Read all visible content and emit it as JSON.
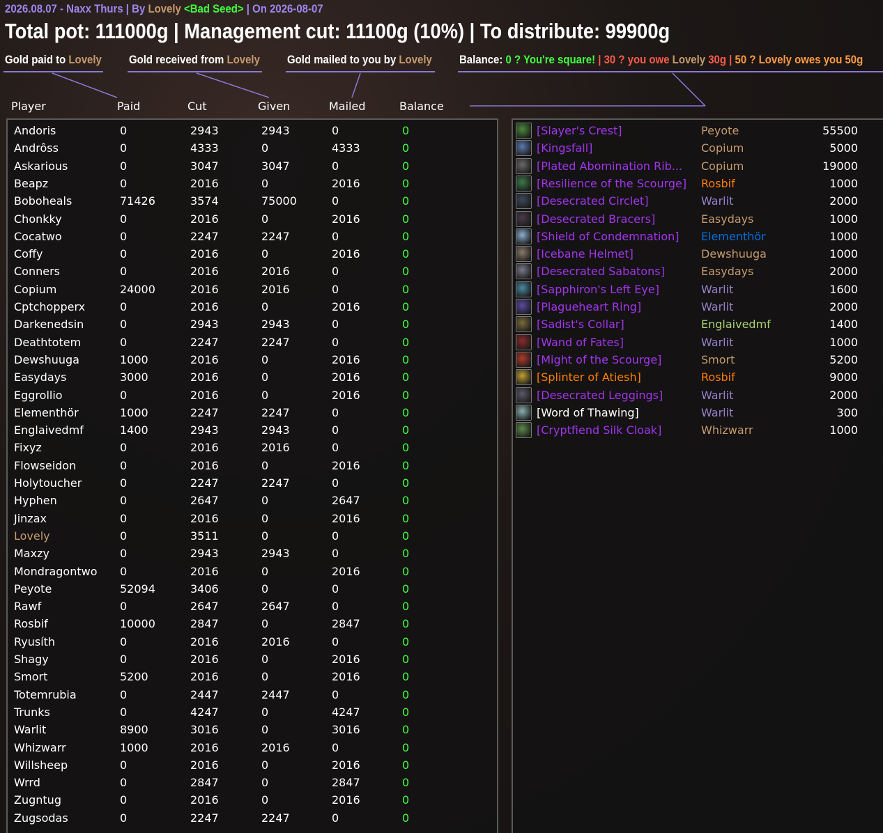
{
  "header": {
    "date": "2026.08.07",
    "sub_mid": " - Naxx Thurs | By ",
    "leader": "Lovely",
    "guild": "<Bad Seed>",
    "sub_end": " | On 2026-08-07",
    "title": "Total pot: 111000g | Management cut: 11100g (10%) | To distribute: 99900g"
  },
  "legend": {
    "paid_prefix": "Gold paid to ",
    "received_prefix": "Gold received from ",
    "mailed_prefix": "Gold mailed to you by ",
    "leader": "Lovely",
    "balance_label": "Balance: ",
    "square_text": "0 ? You're square!",
    "sep": " | ",
    "owe_prefix": "30 ? you owe ",
    "owe_suffix": " 30g",
    "owes_text": "50 ? Lovely owes you 50g"
  },
  "columns": {
    "player": "Player",
    "paid": "Paid",
    "cut": "Cut",
    "given": "Given",
    "mailed": "Mailed",
    "balance": "Balance"
  },
  "colors": {
    "purple_epic": "#a335ee",
    "legendary": "#ff8000",
    "shaman": "#0070dd",
    "hunter": "#abd473",
    "priest": "#ffffff",
    "balance_green": "#40ff40",
    "leader": "#c69b6d"
  },
  "players": [
    {
      "name": "Andoris",
      "paid": "0",
      "cut": "2943",
      "given": "2943",
      "mailed": "0",
      "balance": "0"
    },
    {
      "name": "Andrôss",
      "paid": "0",
      "cut": "4333",
      "given": "0",
      "mailed": "4333",
      "balance": "0"
    },
    {
      "name": "Askarious",
      "paid": "0",
      "cut": "3047",
      "given": "3047",
      "mailed": "0",
      "balance": "0"
    },
    {
      "name": "Beapz",
      "paid": "0",
      "cut": "2016",
      "given": "0",
      "mailed": "2016",
      "balance": "0"
    },
    {
      "name": "Boboheals",
      "paid": "71426",
      "cut": "3574",
      "given": "75000",
      "mailed": "0",
      "balance": "0"
    },
    {
      "name": "Chonkky",
      "paid": "0",
      "cut": "2016",
      "given": "0",
      "mailed": "2016",
      "balance": "0"
    },
    {
      "name": "Cocatwo",
      "paid": "0",
      "cut": "2247",
      "given": "2247",
      "mailed": "0",
      "balance": "0"
    },
    {
      "name": "Coffy",
      "paid": "0",
      "cut": "2016",
      "given": "0",
      "mailed": "2016",
      "balance": "0"
    },
    {
      "name": "Conners",
      "paid": "0",
      "cut": "2016",
      "given": "2016",
      "mailed": "0",
      "balance": "0"
    },
    {
      "name": "Copium",
      "paid": "24000",
      "cut": "2016",
      "given": "2016",
      "mailed": "0",
      "balance": "0"
    },
    {
      "name": "Cptchopperx",
      "paid": "0",
      "cut": "2016",
      "given": "0",
      "mailed": "2016",
      "balance": "0"
    },
    {
      "name": "Darkenedsin",
      "paid": "0",
      "cut": "2943",
      "given": "2943",
      "mailed": "0",
      "balance": "0"
    },
    {
      "name": "Deathtotem",
      "paid": "0",
      "cut": "2247",
      "given": "2247",
      "mailed": "0",
      "balance": "0"
    },
    {
      "name": "Dewshuuga",
      "paid": "1000",
      "cut": "2016",
      "given": "0",
      "mailed": "2016",
      "balance": "0"
    },
    {
      "name": "Easydays",
      "paid": "3000",
      "cut": "2016",
      "given": "0",
      "mailed": "2016",
      "balance": "0"
    },
    {
      "name": "Eggrollio",
      "paid": "0",
      "cut": "2016",
      "given": "0",
      "mailed": "2016",
      "balance": "0"
    },
    {
      "name": "Elementhör",
      "paid": "1000",
      "cut": "2247",
      "given": "2247",
      "mailed": "0",
      "balance": "0"
    },
    {
      "name": "Englaivedmf",
      "paid": "1400",
      "cut": "2943",
      "given": "2943",
      "mailed": "0",
      "balance": "0"
    },
    {
      "name": "Fixyz",
      "paid": "0",
      "cut": "2016",
      "given": "2016",
      "mailed": "0",
      "balance": "0"
    },
    {
      "name": "Flowseidon",
      "paid": "0",
      "cut": "2016",
      "given": "0",
      "mailed": "2016",
      "balance": "0"
    },
    {
      "name": "Holytoucher",
      "paid": "0",
      "cut": "2247",
      "given": "2247",
      "mailed": "0",
      "balance": "0"
    },
    {
      "name": "Hyphen",
      "paid": "0",
      "cut": "2647",
      "given": "0",
      "mailed": "2647",
      "balance": "0"
    },
    {
      "name": "Jinzax",
      "paid": "0",
      "cut": "2016",
      "given": "0",
      "mailed": "2016",
      "balance": "0"
    },
    {
      "name": "Lovely",
      "paid": "0",
      "cut": "3511",
      "given": "0",
      "mailed": "0",
      "balance": "0",
      "leader": true
    },
    {
      "name": "Maxzy",
      "paid": "0",
      "cut": "2943",
      "given": "2943",
      "mailed": "0",
      "balance": "0"
    },
    {
      "name": "Mondragontwo",
      "paid": "0",
      "cut": "2016",
      "given": "0",
      "mailed": "2016",
      "balance": "0"
    },
    {
      "name": "Peyote",
      "paid": "52094",
      "cut": "3406",
      "given": "0",
      "mailed": "0",
      "balance": "0"
    },
    {
      "name": "Rawf",
      "paid": "0",
      "cut": "2647",
      "given": "2647",
      "mailed": "0",
      "balance": "0"
    },
    {
      "name": "Rosbif",
      "paid": "10000",
      "cut": "2847",
      "given": "0",
      "mailed": "2847",
      "balance": "0"
    },
    {
      "name": "Ryusíth",
      "paid": "0",
      "cut": "2016",
      "given": "2016",
      "mailed": "0",
      "balance": "0"
    },
    {
      "name": "Shagy",
      "paid": "0",
      "cut": "2016",
      "given": "0",
      "mailed": "2016",
      "balance": "0"
    },
    {
      "name": "Smort",
      "paid": "5200",
      "cut": "2016",
      "given": "0",
      "mailed": "2016",
      "balance": "0"
    },
    {
      "name": "Totemrubia",
      "paid": "0",
      "cut": "2447",
      "given": "2447",
      "mailed": "0",
      "balance": "0"
    },
    {
      "name": "Trunks",
      "paid": "0",
      "cut": "4247",
      "given": "0",
      "mailed": "4247",
      "balance": "0"
    },
    {
      "name": "Warlit",
      "paid": "8900",
      "cut": "3016",
      "given": "0",
      "mailed": "3016",
      "balance": "0"
    },
    {
      "name": "Whizwarr",
      "paid": "1000",
      "cut": "2016",
      "given": "2016",
      "mailed": "0",
      "balance": "0"
    },
    {
      "name": "Willsheep",
      "paid": "0",
      "cut": "2016",
      "given": "0",
      "mailed": "2016",
      "balance": "0"
    },
    {
      "name": "Wrrd",
      "paid": "0",
      "cut": "2847",
      "given": "0",
      "mailed": "2847",
      "balance": "0"
    },
    {
      "name": "Zugntug",
      "paid": "0",
      "cut": "2016",
      "given": "0",
      "mailed": "2016",
      "balance": "0"
    },
    {
      "name": "Zugsodas",
      "paid": "0",
      "cut": "2247",
      "given": "2247",
      "mailed": "0",
      "balance": "0"
    }
  ],
  "items": [
    {
      "name": "[Slayer's Crest]",
      "winner": "Peyote",
      "price": "55500",
      "item_color": "#a335ee",
      "winner_color": "#c69b6d",
      "icon": "crest-icon",
      "icon_color": "#4a8a3a"
    },
    {
      "name": "[Kingsfall]",
      "winner": "Copium",
      "price": "5000",
      "item_color": "#a335ee",
      "winner_color": "#c69b6d",
      "icon": "dagger-icon",
      "icon_color": "#5a7ab0"
    },
    {
      "name": "[Plated Abomination Rib...",
      "winner": "Copium",
      "price": "19000",
      "item_color": "#a335ee",
      "winner_color": "#c69b6d",
      "icon": "chest-armor-icon",
      "icon_color": "#6a6a6a"
    },
    {
      "name": "[Resilience of the Scourge]",
      "winner": "Rosbif",
      "price": "1000",
      "item_color": "#a335ee",
      "winner_color": "#ff7d0a",
      "icon": "trinket-icon",
      "icon_color": "#3a7a4a"
    },
    {
      "name": "[Desecrated Circlet]",
      "winner": "Warlit",
      "price": "2000",
      "item_color": "#a335ee",
      "winner_color": "#9482c9",
      "icon": "helm-icon",
      "icon_color": "#3a4a5a"
    },
    {
      "name": "[Desecrated Bracers]",
      "winner": "Easydays",
      "price": "1000",
      "item_color": "#a335ee",
      "winner_color": "#c69b6d",
      "icon": "bracers-icon",
      "icon_color": "#4a3a4a"
    },
    {
      "name": "[Shield of Condemnation]",
      "winner": "Elementhör",
      "price": "1000",
      "item_color": "#a335ee",
      "winner_color": "#0070dd",
      "icon": "shield-icon",
      "icon_color": "#8ab0d0"
    },
    {
      "name": "[Icebane Helmet]",
      "winner": "Dewshuuga",
      "price": "1000",
      "item_color": "#a335ee",
      "winner_color": "#c69b6d",
      "icon": "helmet-icon",
      "icon_color": "#8a7a6a"
    },
    {
      "name": "[Desecrated Sabatons]",
      "winner": "Easydays",
      "price": "2000",
      "item_color": "#a335ee",
      "winner_color": "#c69b6d",
      "icon": "boots-icon",
      "icon_color": "#7a7a8a"
    },
    {
      "name": "[Sapphiron's Left Eye]",
      "winner": "Warlit",
      "price": "1600",
      "item_color": "#a335ee",
      "winner_color": "#9482c9",
      "icon": "eye-icon",
      "icon_color": "#4a8aa0"
    },
    {
      "name": "[Plagueheart Ring]",
      "winner": "Warlit",
      "price": "2000",
      "item_color": "#a335ee",
      "winner_color": "#9482c9",
      "icon": "ring-icon",
      "icon_color": "#5a4aa0"
    },
    {
      "name": "[Sadist's Collar]",
      "winner": "Englaivedmf",
      "price": "1400",
      "item_color": "#a335ee",
      "winner_color": "#abd473",
      "icon": "necklace-icon",
      "icon_color": "#7a6a3a"
    },
    {
      "name": "[Wand of Fates]",
      "winner": "Warlit",
      "price": "1000",
      "item_color": "#a335ee",
      "winner_color": "#9482c9",
      "icon": "wand-icon",
      "icon_color": "#8a2a2a"
    },
    {
      "name": "[Might of the Scourge]",
      "winner": "Smort",
      "price": "5200",
      "item_color": "#a335ee",
      "winner_color": "#c69b6d",
      "icon": "shoulder-icon",
      "icon_color": "#b03a2a"
    },
    {
      "name": "[Splinter of Atiesh]",
      "winner": "Rosbif",
      "price": "9000",
      "item_color": "#ff8000",
      "winner_color": "#ff7d0a",
      "icon": "splinter-icon",
      "icon_color": "#c0a030"
    },
    {
      "name": "[Desecrated Leggings]",
      "winner": "Warlit",
      "price": "2000",
      "item_color": "#a335ee",
      "winner_color": "#9482c9",
      "icon": "leggings-icon",
      "icon_color": "#5a5a6a"
    },
    {
      "name": "[Word of Thawing]",
      "winner": "Warlit",
      "price": "300",
      "item_color": "#ffffff",
      "winner_color": "#9482c9",
      "icon": "scroll-icon",
      "icon_color": "#8ab0b0"
    },
    {
      "name": "[Cryptfiend Silk Cloak]",
      "winner": "Whizwarr",
      "price": "1000",
      "item_color": "#a335ee",
      "winner_color": "#c69b6d",
      "icon": "cloak-icon",
      "icon_color": "#5a8a4a"
    }
  ]
}
